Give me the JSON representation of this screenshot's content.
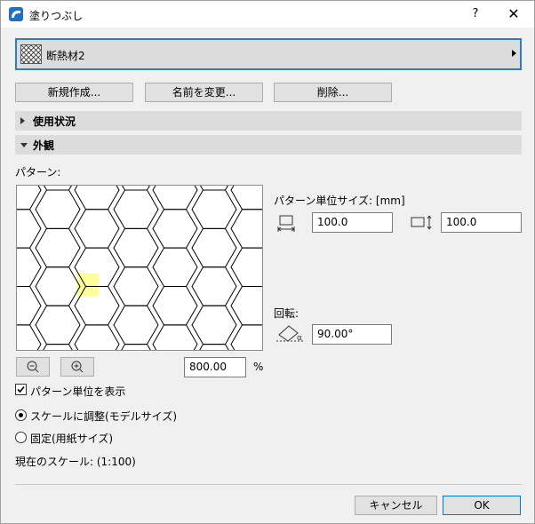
{
  "window": {
    "title": "塗りつぶし",
    "help": "?",
    "close": "✕"
  },
  "material": {
    "name": "断熱材2"
  },
  "buttons": {
    "new": "新規作成...",
    "rename": "名前を変更...",
    "delete": "削除..."
  },
  "sections": {
    "usage": "使用状況",
    "appearance": "外観"
  },
  "pattern": {
    "label": "パターン:",
    "unit_size_label": "パターン単位サイズ: [mm]",
    "width": "100.0",
    "height": "100.0",
    "rotation_label": "回転:",
    "rotation": "90.00°",
    "zoom": "800.00",
    "zoom_unit": "%",
    "highlight_color": "#ffff99"
  },
  "options": {
    "show_unit": "パターン単位を表示",
    "scale_model": "スケールに調整(モデルサイズ)",
    "fixed_paper": "固定(用紙サイズ)",
    "current_scale": "現在のスケール: (1:100)"
  },
  "footer": {
    "cancel": "キャンセル",
    "ok": "OK"
  }
}
